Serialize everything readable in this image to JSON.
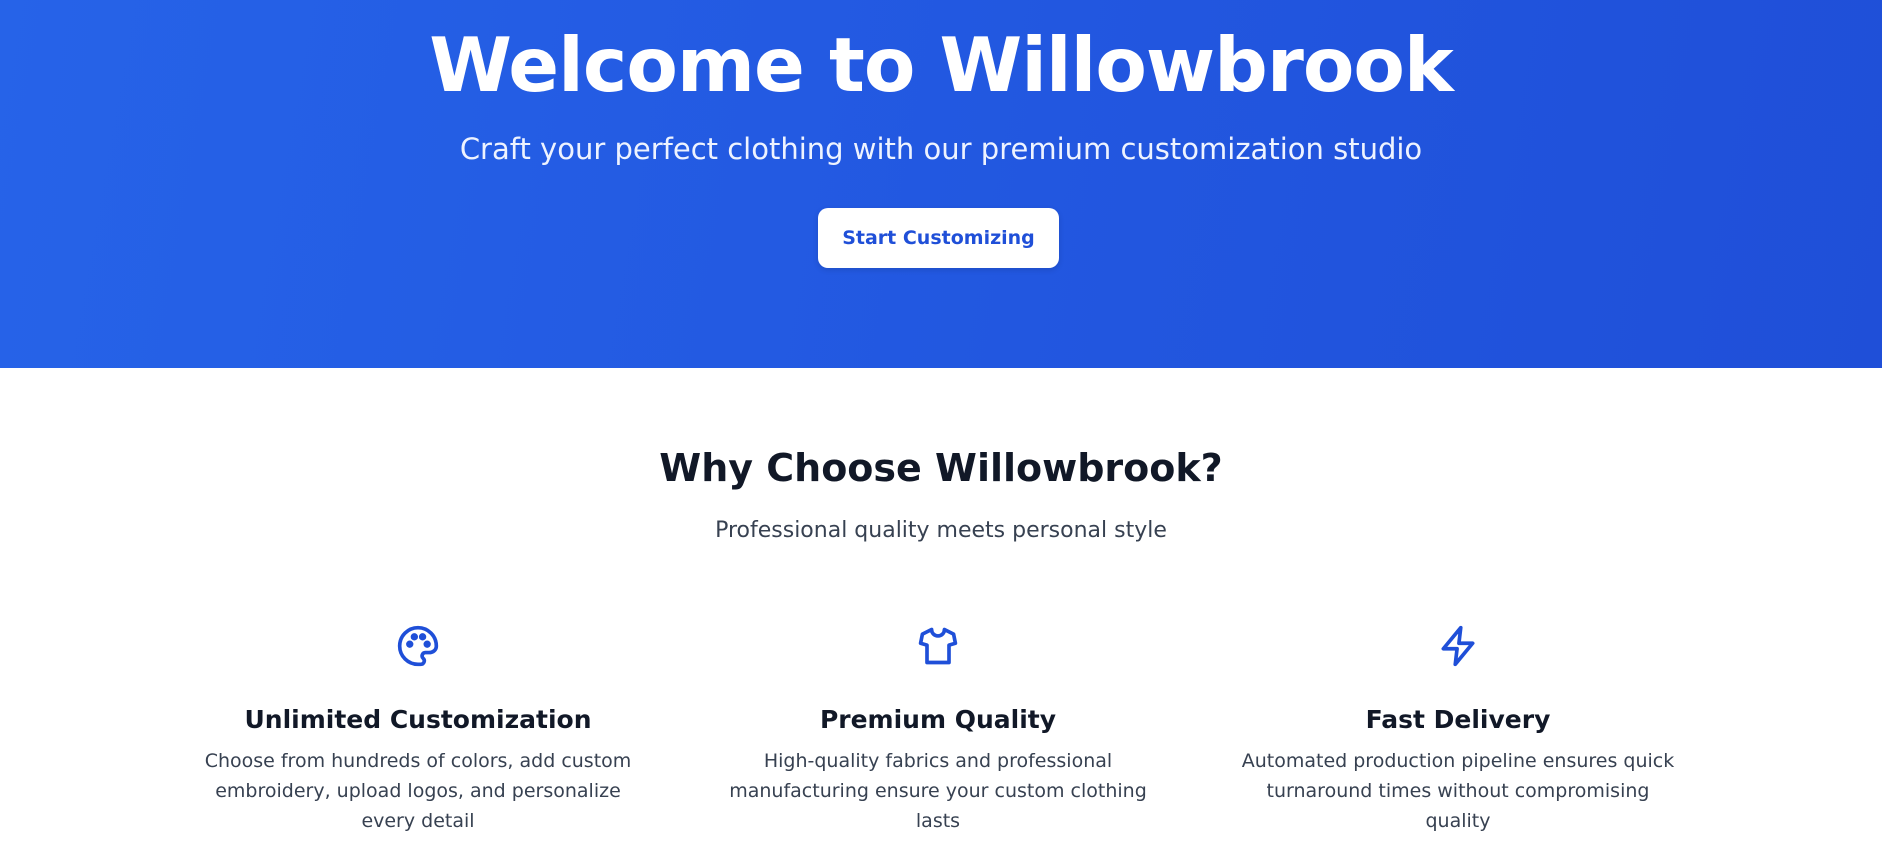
{
  "theme": {
    "hero_gradient_start": "#2663e8",
    "hero_gradient_end": "#1f4fd8",
    "accent": "#1f4fd8",
    "text_dark": "#111827",
    "text_muted": "#374151"
  },
  "hero": {
    "title": "Welcome to Willowbrook",
    "subtitle": "Craft your perfect clothing with our premium customization studio",
    "cta_label": "Start Customizing"
  },
  "features": {
    "title": "Why Choose Willowbrook?",
    "subtitle": "Professional quality meets personal style",
    "items": [
      {
        "icon": "palette-icon",
        "title": "Unlimited Customization",
        "description": "Choose from hundreds of colors, add custom embroidery, upload logos, and personalize every detail"
      },
      {
        "icon": "shirt-icon",
        "title": "Premium Quality",
        "description": "High-quality fabrics and professional manufacturing ensure your custom clothing lasts"
      },
      {
        "icon": "lightning-icon",
        "title": "Fast Delivery",
        "description": "Automated production pipeline ensures quick turnaround times without compromising quality"
      }
    ]
  }
}
